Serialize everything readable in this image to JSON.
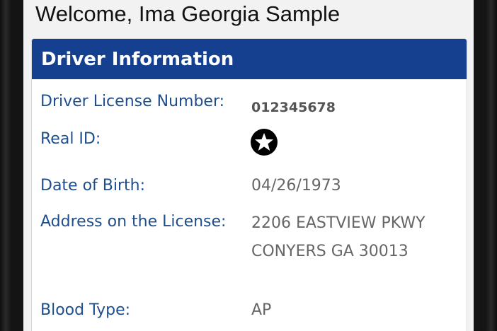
{
  "page": {
    "welcome": "Welcome, Ima Georgia Sample"
  },
  "driver_info": {
    "title": "Driver Information",
    "rows": {
      "license_number": {
        "label": "Driver License Number:",
        "value": "012345678"
      },
      "real_id": {
        "label": "Real ID:",
        "icon": "star-icon"
      },
      "dob": {
        "label": "Date of Birth:",
        "value": "04/26/1973"
      },
      "address": {
        "label": "Address on the License:",
        "line1": "2206 EASTVIEW PKWY",
        "line2": "CONYERS GA 30013"
      },
      "blood_type": {
        "label": "Blood Type:",
        "value": "AP"
      }
    }
  },
  "colors": {
    "header_bg": "#15408f",
    "label_text": "#1f4e8c",
    "value_text": "#666666"
  }
}
